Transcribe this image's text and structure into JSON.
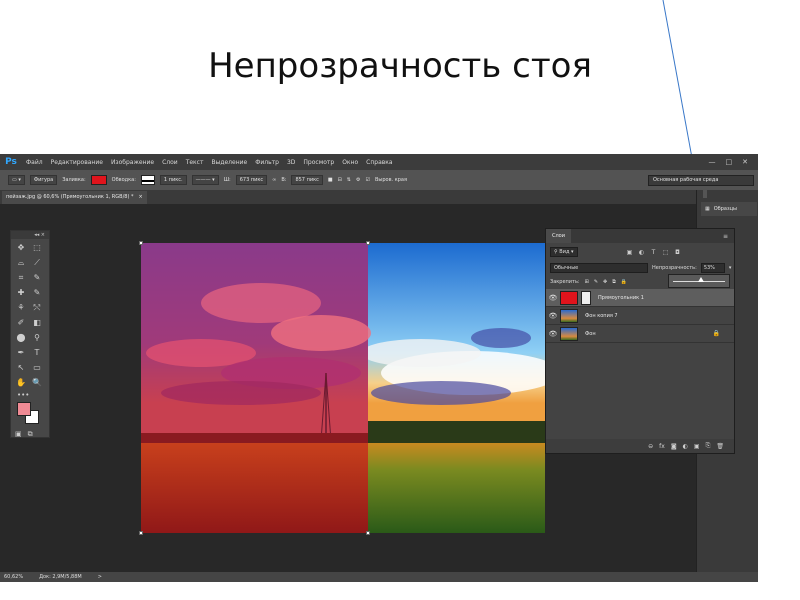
{
  "slide": {
    "title": "Непрозрачность стоя"
  },
  "app": {
    "logo": "Ps",
    "menu": [
      "Файл",
      "Редактирование",
      "Изображение",
      "Слои",
      "Текст",
      "Выделение",
      "Фильтр",
      "3D",
      "Просмотр",
      "Окно",
      "Справка"
    ],
    "window_controls": [
      "—",
      "□",
      "✕"
    ]
  },
  "options_bar": {
    "mode": "Фигура",
    "fill_label": "Заливка:",
    "stroke_label": "Обводка:",
    "stroke_width": "1 пикс.",
    "w_label": "Ш:",
    "w_value": "673 пикс",
    "link_icon": "link-icon",
    "h_label": "В:",
    "h_value": "857 пикс",
    "align_edges_label": "Выров. края",
    "workspace": "Основная рабочая среда",
    "fill_color": "#e0141c"
  },
  "document": {
    "tab_title": "пейзаж.jpg @ 60,6% (Прямоугольник 1, RGB/8) *",
    "close_glyph": "×"
  },
  "toolbar": {
    "header_glyph": "◂◂ ×",
    "tools": [
      "✥",
      "⬚",
      "⌓",
      "⟋",
      "⌗",
      "✎",
      "✚",
      "✎",
      "⚘",
      "⤲",
      "✐",
      "◧",
      "⬤",
      "⚲",
      "✒",
      "T",
      "↖",
      "▭",
      "✋",
      "🔍"
    ],
    "more": "•••",
    "foreground_color": "#f08a94",
    "background_color": "#ffffff",
    "bottom": [
      "▣",
      "⧉"
    ]
  },
  "swatches_panel": {
    "label": "Образцы"
  },
  "layers_panel": {
    "tab": "Слои",
    "menu_glyph": "≡",
    "filter_kind": "Вид",
    "filter_icons": [
      "▣",
      "◐",
      "T",
      "⬚",
      "◘"
    ],
    "blend_mode": "Обычные",
    "opacity_label": "Непрозрачность:",
    "opacity_value": "53%",
    "opacity_percent": 53,
    "lock_label": "Закрепить:",
    "lock_icons": [
      "⊞",
      "✎",
      "✥",
      "⧉",
      "🔒"
    ],
    "layers": [
      {
        "name": "Прямоугольник 1",
        "visible": true,
        "selected": true,
        "lock": ""
      },
      {
        "name": "Фон копия 7",
        "visible": true,
        "selected": false,
        "lock": ""
      },
      {
        "name": "Фон",
        "visible": true,
        "selected": false,
        "lock": "🔒"
      }
    ],
    "footer_icons": [
      "⊖",
      "fx",
      "◙",
      "◐",
      "▣",
      "⎘",
      "🗑"
    ]
  },
  "status_bar": {
    "zoom": "60,62%",
    "doc_size": "Док: 2,9M/5,88M",
    "arrow": ">"
  }
}
